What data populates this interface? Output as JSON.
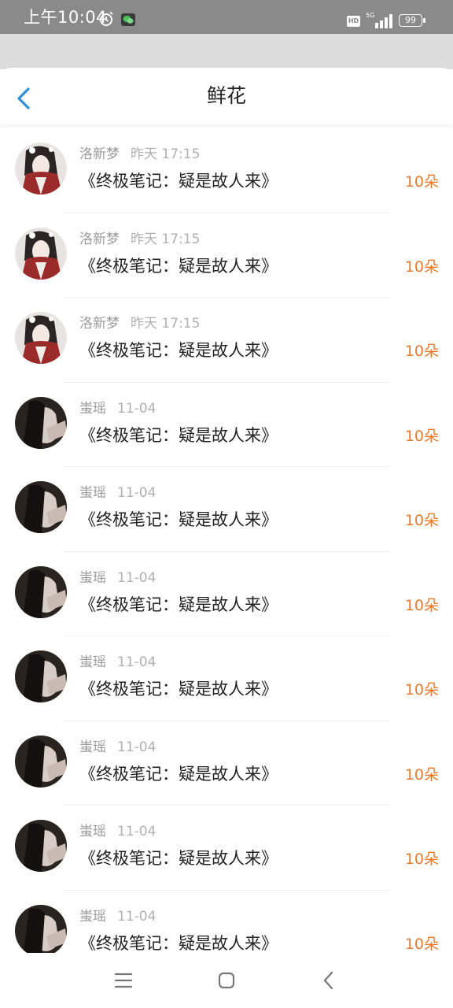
{
  "status_bar": {
    "time": "上午10:04",
    "hd": "HD",
    "network": "5G",
    "battery": "99"
  },
  "header": {
    "title": "鲜花",
    "back_icon": "chevron-left-icon",
    "accent_color": "#2f8fd8"
  },
  "list": {
    "items": [
      {
        "user": "洛新梦",
        "time": "昨天 17:15",
        "book": "《终极笔记：疑是故人来》",
        "amount": "10朵",
        "avatar": "avatar-a"
      },
      {
        "user": "洛新梦",
        "time": "昨天 17:15",
        "book": "《终极笔记：疑是故人来》",
        "amount": "10朵",
        "avatar": "avatar-a"
      },
      {
        "user": "洛新梦",
        "time": "昨天 17:15",
        "book": "《终极笔记：疑是故人来》",
        "amount": "10朵",
        "avatar": "avatar-a"
      },
      {
        "user": "蚩瑶",
        "time": "11-04",
        "book": "《终极笔记：疑是故人来》",
        "amount": "10朵",
        "avatar": "avatar-b"
      },
      {
        "user": "蚩瑶",
        "time": "11-04",
        "book": "《终极笔记：疑是故人来》",
        "amount": "10朵",
        "avatar": "avatar-b"
      },
      {
        "user": "蚩瑶",
        "time": "11-04",
        "book": "《终极笔记：疑是故人来》",
        "amount": "10朵",
        "avatar": "avatar-b"
      },
      {
        "user": "蚩瑶",
        "time": "11-04",
        "book": "《终极笔记：疑是故人来》",
        "amount": "10朵",
        "avatar": "avatar-b"
      },
      {
        "user": "蚩瑶",
        "time": "11-04",
        "book": "《终极笔记：疑是故人来》",
        "amount": "10朵",
        "avatar": "avatar-b"
      },
      {
        "user": "蚩瑶",
        "time": "11-04",
        "book": "《终极笔记：疑是故人来》",
        "amount": "10朵",
        "avatar": "avatar-b"
      },
      {
        "user": "蚩瑶",
        "time": "11-04",
        "book": "《终极笔记：疑是故人来》",
        "amount": "10朵",
        "avatar": "avatar-b"
      }
    ]
  },
  "colors": {
    "amount": "#e87a2e",
    "status_bar_bg": "#8a8a8a"
  },
  "nav_bar": {
    "icons": [
      "menu-icon",
      "home-icon",
      "back-icon"
    ]
  }
}
